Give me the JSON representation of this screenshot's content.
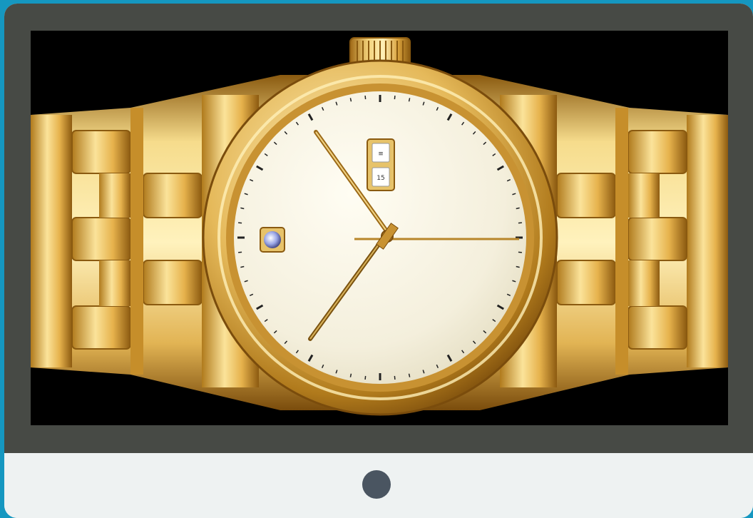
{
  "image": {
    "subject": "gold-wristwatch",
    "date_window_top": "≡",
    "date_window_bottom": "15"
  },
  "device": {
    "power_button_icon": "circle-icon",
    "colors": {
      "background": "#1597c0",
      "bezel": "#474a45",
      "chin": "#eef2f2",
      "power_button": "#4a5561",
      "screen_background": "#000000",
      "gold": "#d9a93b",
      "dial": "#f7f3e3"
    }
  }
}
